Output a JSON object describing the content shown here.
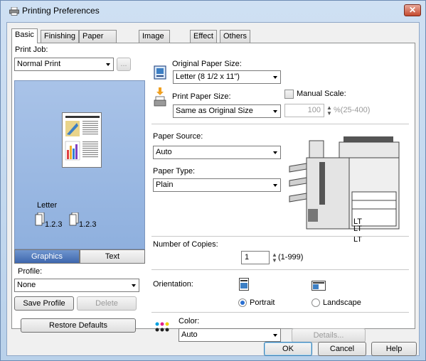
{
  "window": {
    "title": "Printing Preferences",
    "close_label": "✕"
  },
  "tabs": [
    {
      "label": "Basic"
    },
    {
      "label": "Finishing"
    },
    {
      "label": "Paper Handling"
    },
    {
      "label": "Image Quality"
    },
    {
      "label": "Effect"
    },
    {
      "label": "Others"
    }
  ],
  "left": {
    "print_job_label": "Print Job:",
    "print_job_value": "Normal Print",
    "print_job_more": "...",
    "preview_paper": "Letter",
    "page_order_1": "1.2.3",
    "page_order_2": "1.2.3",
    "graphics_label": "Graphics",
    "text_label": "Text",
    "profile_label": "Profile:",
    "profile_value": "None",
    "save_profile_label": "Save Profile",
    "delete_label": "Delete",
    "restore_label": "Restore Defaults"
  },
  "paper": {
    "original_label": "Original Paper Size:",
    "original_value": "Letter (8 1/2 x 11\")",
    "print_label": "Print Paper Size:",
    "print_value": "Same as Original Size",
    "manual_scale_label": "Manual Scale:",
    "scale_value": "100",
    "scale_range": "%(25-400)"
  },
  "source": {
    "source_label": "Paper Source:",
    "source_value": "Auto",
    "type_label": "Paper Type:",
    "type_value": "Plain",
    "tray_1": "LT",
    "tray_2": "LT",
    "tray_3": "LT",
    "tray_4": "LT"
  },
  "copies": {
    "label": "Number of Copies:",
    "value": "1",
    "range": "(1-999)"
  },
  "orientation": {
    "label": "Orientation:",
    "portrait": "Portrait",
    "landscape": "Landscape"
  },
  "color": {
    "label": "Color:",
    "value": "Auto",
    "details_label": "Details..."
  },
  "footer": {
    "ok": "OK",
    "cancel": "Cancel",
    "help": "Help"
  }
}
